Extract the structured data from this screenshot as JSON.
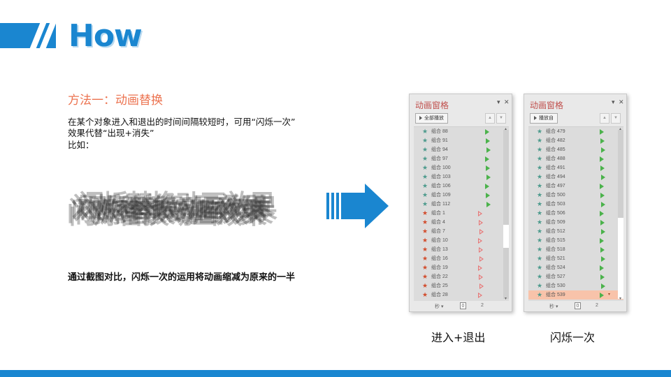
{
  "header": {
    "title": "How"
  },
  "content": {
    "method_title": "方法一：动画替换",
    "description_lines": [
      "在某个对象进入和退出的时间间隔较短时，可用“闪烁一次”",
      "效果代替“出现+消失”",
      "比如："
    ],
    "blurred_sample_text": "闪烁替换动画效果",
    "comparison_note": "通过截图对比，闪烁一次的运用将动画缩减为原来的一半"
  },
  "panels": [
    {
      "title": "动画窗格",
      "controls": [
        "▾",
        "✕"
      ],
      "play_button": "全部播放",
      "timeline": {
        "unit": "秒 ▾",
        "start": "0",
        "end": "2"
      },
      "caption": "进入+退出",
      "scroll_thumb": {
        "start": 0.56,
        "end": 0.7
      },
      "rows": [
        {
          "star": "green",
          "label": "组合 88",
          "tri": "green"
        },
        {
          "star": "green",
          "label": "组合 91",
          "tri": "green"
        },
        {
          "star": "green",
          "label": "组合 94",
          "tri": "green"
        },
        {
          "star": "green",
          "label": "组合 97",
          "tri": "green"
        },
        {
          "star": "green",
          "label": "组合 100",
          "tri": "green"
        },
        {
          "star": "green",
          "label": "组合 103",
          "tri": "green"
        },
        {
          "star": "green",
          "label": "组合 106",
          "tri": "green"
        },
        {
          "star": "green",
          "label": "组合 109",
          "tri": "green"
        },
        {
          "star": "green",
          "label": "组合 112",
          "tri": "green"
        },
        {
          "star": "red",
          "label": "组合 1",
          "tri": "red"
        },
        {
          "star": "red",
          "label": "组合 4",
          "tri": "red"
        },
        {
          "star": "red",
          "label": "组合 7",
          "tri": "red"
        },
        {
          "star": "red",
          "label": "组合 10",
          "tri": "red"
        },
        {
          "star": "red",
          "label": "组合 13",
          "tri": "red"
        },
        {
          "star": "red",
          "label": "组合 16",
          "tri": "red"
        },
        {
          "star": "red",
          "label": "组合 19",
          "tri": "red"
        },
        {
          "star": "red",
          "label": "组合 22",
          "tri": "red"
        },
        {
          "star": "red",
          "label": "组合 25",
          "tri": "red"
        },
        {
          "star": "red",
          "label": "组合 28",
          "tri": "red"
        }
      ]
    },
    {
      "title": "动画窗格",
      "controls": [
        "▾",
        "✕"
      ],
      "play_button": "播放自",
      "timeline": {
        "unit": "秒 ▾",
        "start": "0",
        "end": "2"
      },
      "caption": "闪烁一次",
      "scroll_thumb": {
        "start": 0.52,
        "end": 1.0
      },
      "rows": [
        {
          "star": "green",
          "label": "组合 479",
          "tri": "green"
        },
        {
          "star": "green",
          "label": "组合 482",
          "tri": "green"
        },
        {
          "star": "green",
          "label": "组合 485",
          "tri": "green"
        },
        {
          "star": "green",
          "label": "组合 488",
          "tri": "green"
        },
        {
          "star": "green",
          "label": "组合 491",
          "tri": "green"
        },
        {
          "star": "green",
          "label": "组合 494",
          "tri": "green"
        },
        {
          "star": "green",
          "label": "组合 497",
          "tri": "green"
        },
        {
          "star": "green",
          "label": "组合 500",
          "tri": "green"
        },
        {
          "star": "green",
          "label": "组合 503",
          "tri": "green"
        },
        {
          "star": "green",
          "label": "组合 506",
          "tri": "green"
        },
        {
          "star": "green",
          "label": "组合 509",
          "tri": "green"
        },
        {
          "star": "green",
          "label": "组合 512",
          "tri": "green"
        },
        {
          "star": "green",
          "label": "组合 515",
          "tri": "green"
        },
        {
          "star": "green",
          "label": "组合 518",
          "tri": "green"
        },
        {
          "star": "green",
          "label": "组合 521",
          "tri": "green"
        },
        {
          "star": "green",
          "label": "组合 524",
          "tri": "green"
        },
        {
          "star": "green",
          "label": "组合 527",
          "tri": "green"
        },
        {
          "star": "green",
          "label": "组合 530",
          "tri": "green"
        },
        {
          "star": "green",
          "label": "组合 539",
          "tri": "green",
          "selected": true,
          "dropdown": "▾"
        }
      ]
    }
  ],
  "colors": {
    "accent": "#1a86d0",
    "method_title": "#ec7350",
    "panel_title": "#c0504d",
    "entrance_star": "#4c9a8c",
    "exit_star": "#d24b2b",
    "selected_row": "#f8c3aa"
  },
  "icons": [
    "header-slash-icon",
    "arrow-right-icon",
    "play-icon",
    "move-up-icon",
    "move-down-icon",
    "star-icon",
    "triangle-icon",
    "close-icon"
  ]
}
